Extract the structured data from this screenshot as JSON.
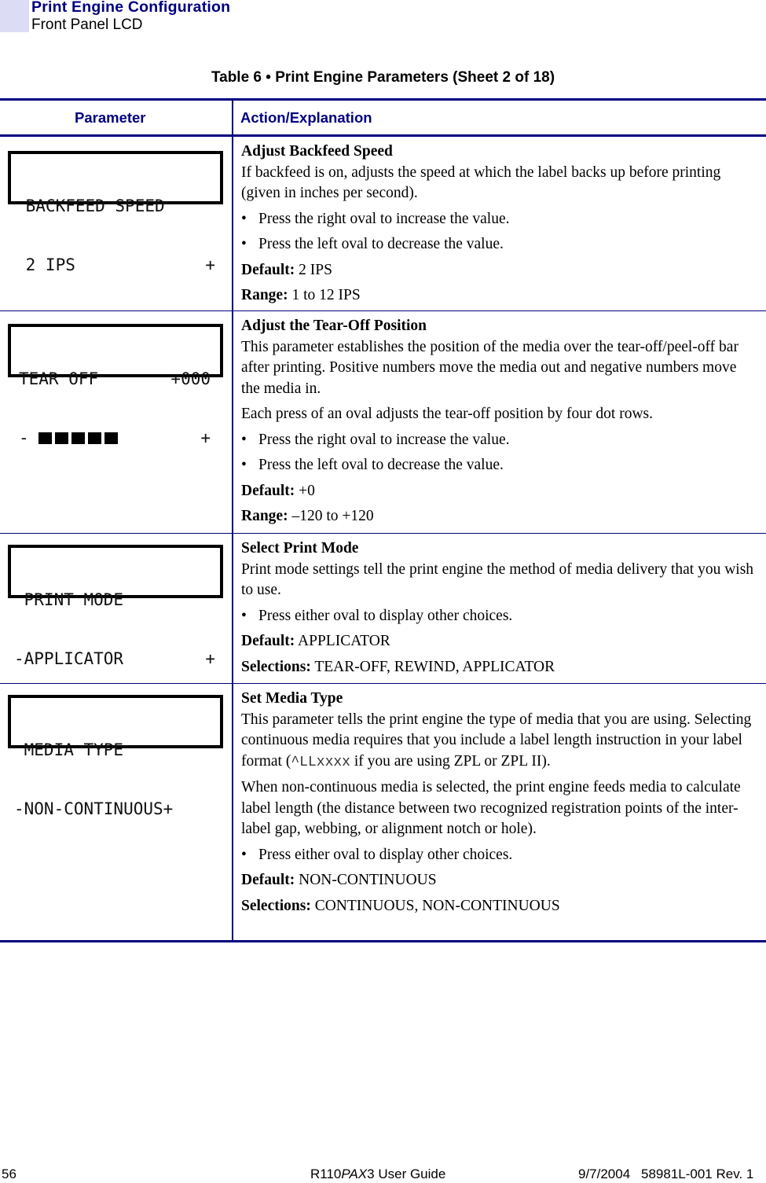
{
  "header": {
    "title": "Print Engine Configuration",
    "subtitle": "Front Panel LCD"
  },
  "table": {
    "caption": "Table 6 • Print Engine Parameters (Sheet 2 of 18)",
    "columns": [
      "Parameter",
      "Action/Explanation"
    ],
    "rows": [
      {
        "lcd": {
          "line1": " BACKFEED SPEED",
          "line2": " 2 IPS",
          "line2_right": "+"
        },
        "heading": "Adjust Backfeed Speed",
        "paragraphs": [
          "If backfeed is on, adjusts the speed at which the label backs up before printing (given in inches per second)."
        ],
        "bullets": [
          "Press the right oval to increase the value.",
          "Press the left oval to decrease the value."
        ],
        "fields": [
          {
            "label": "Default:",
            "value": " 2 IPS"
          },
          {
            "label": "Range:",
            "value": " 1 to 12 IPS"
          }
        ]
      },
      {
        "lcd": {
          "line1": "TEAR OFF",
          "line1_right": "+000",
          "line2_left": "-",
          "line2_blocks": 5,
          "line2_right": "+"
        },
        "heading": "Adjust the Tear-Off Position",
        "paragraphs": [
          "This parameter establishes the position of the media over the tear-off/peel-off bar after printing. Positive numbers move the media out and negative numbers move the media in.",
          "Each press of an oval adjusts the tear-off position by four dot rows."
        ],
        "bullets": [
          "Press the right oval to increase the value.",
          "Press the left oval to decrease the value."
        ],
        "fields": [
          {
            "label": "Default:",
            "value": " +0"
          },
          {
            "label": "Range:",
            "value": " –120 to +120"
          }
        ]
      },
      {
        "lcd": {
          "line1": " PRINT MODE",
          "line2": "-APPLICATOR",
          "line2_right": "+"
        },
        "heading": "Select Print Mode",
        "paragraphs": [
          "Print mode settings tell the print engine the method of media delivery that you wish to use."
        ],
        "bullets": [
          "Press either oval to display other choices."
        ],
        "fields": [
          {
            "label": "Default:",
            "value": " APPLICATOR"
          },
          {
            "label": "Selections:",
            "value": " TEAR-OFF, REWIND, APPLICATOR"
          }
        ]
      },
      {
        "lcd": {
          "line1": " MEDIA TYPE",
          "line2": "-NON-CONTINUOUS+"
        },
        "heading": "Set Media Type",
        "paragraph1_pre": "This parameter tells the print engine the type of media that you are using. Selecting continuous media requires that you include a label length instruction in your label format (",
        "paragraph1_code": "^LLxxxx",
        "paragraph1_post": " if you are using ZPL or ZPL II).",
        "paragraphs": [
          "When non-continuous media is selected, the print engine feeds media to calculate label length (the distance between two recognized registration points of the inter-label gap, webbing, or alignment notch or hole)."
        ],
        "bullets": [
          "Press either oval to display other choices."
        ],
        "fields": [
          {
            "label": "Default:",
            "value": " NON-CONTINUOUS"
          },
          {
            "label": "Selections:",
            "value": " CONTINUOUS, NON-CONTINUOUS"
          }
        ]
      }
    ]
  },
  "footer": {
    "page_number": "56",
    "guide_prefix": "R110",
    "guide_italic": "PAX",
    "guide_suffix": "3 User Guide",
    "date": "9/7/2004",
    "doc_number": "58981L-001 Rev. 1"
  },
  "colors": {
    "accent": "#000080",
    "header_tab": "#dcdcf5"
  }
}
